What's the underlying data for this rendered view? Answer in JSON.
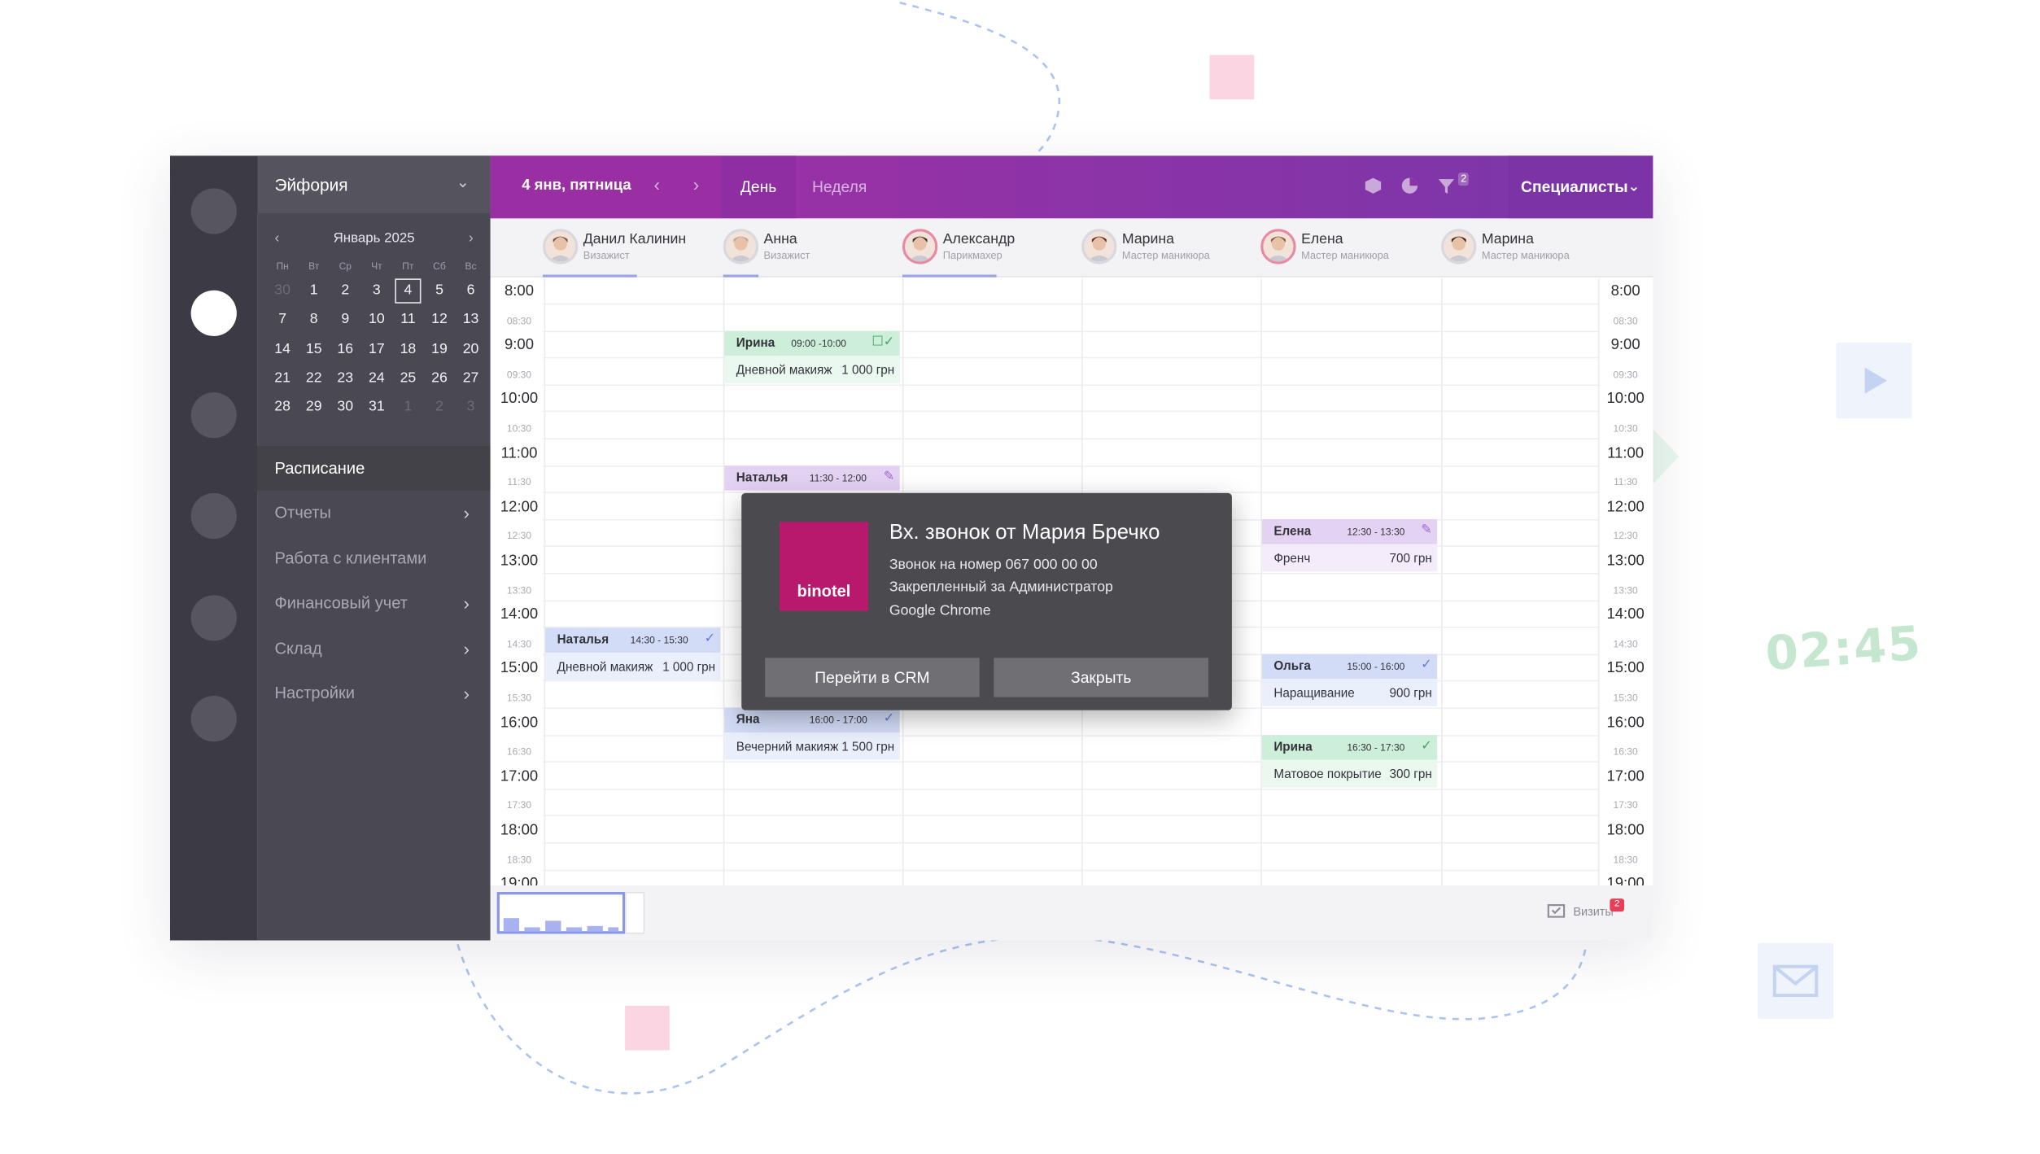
{
  "timer": "02:45",
  "sidebar": {
    "org_name": "Эйфория",
    "calendar": {
      "month_label": "Январь 2025",
      "weekdays": [
        "Пн",
        "Вт",
        "Ср",
        "Чт",
        "Пт",
        "Сб",
        "Вс"
      ],
      "days": [
        "30",
        "1",
        "2",
        "3",
        "4",
        "5",
        "6",
        "7",
        "8",
        "9",
        "10",
        "11",
        "12",
        "13",
        "14",
        "15",
        "16",
        "17",
        "18",
        "19",
        "20",
        "21",
        "22",
        "23",
        "24",
        "25",
        "26",
        "27",
        "28",
        "29",
        "30",
        "31",
        "1",
        "2",
        "3"
      ]
    },
    "menu": [
      "Расписание",
      "Отчеты",
      "Работа с клиентами",
      "Финансовый учет",
      "Склад",
      "Настройки"
    ]
  },
  "topbar": {
    "date_label": "4 янв, пятница",
    "tab_day": "День",
    "tab_week": "Неделя",
    "filter_badge": "2",
    "specialists_btn": "Специалисты"
  },
  "specialists": [
    {
      "name": "Данил Калинин",
      "role": "Визажист"
    },
    {
      "name": "Анна",
      "role": "Визажист"
    },
    {
      "name": "Александр",
      "role": "Парикмахер"
    },
    {
      "name": "Марина",
      "role": "Мастер маникюра"
    },
    {
      "name": "Елена",
      "role": "Мастер маникюра"
    },
    {
      "name": "Марина",
      "role": "Мастер маникюра"
    }
  ],
  "times": [
    {
      "label": "8:00"
    },
    {
      "label": "08:30"
    },
    {
      "label": "9:00"
    },
    {
      "label": "09:30"
    },
    {
      "label": "10:00"
    },
    {
      "label": "10:30"
    },
    {
      "label": "11:00"
    },
    {
      "label": "11:30"
    },
    {
      "label": "12:00"
    },
    {
      "label": "12:30"
    },
    {
      "label": "13:00"
    },
    {
      "label": "13:30"
    },
    {
      "label": "14:00"
    },
    {
      "label": "14:30"
    },
    {
      "label": "15:00"
    },
    {
      "label": "15:30"
    },
    {
      "label": "16:00"
    },
    {
      "label": "16:30"
    },
    {
      "label": "17:00"
    },
    {
      "label": "17:30"
    },
    {
      "label": "18:00"
    },
    {
      "label": "18:30"
    },
    {
      "label": "19:00"
    }
  ],
  "appointments": [
    {
      "client": "Ирина",
      "time": "09:00 -10:00",
      "service": "Дневной макияж",
      "price": "1 000 грн",
      "color": "green"
    },
    {
      "client": "Наталья",
      "time": "11:30 - 12:00",
      "service": "",
      "price": "",
      "color": "purple"
    },
    {
      "client": "Елена",
      "time": "12:30 - 13:30",
      "service": "Френч",
      "price": "700 грн",
      "color": "purple"
    },
    {
      "client": "Наталья",
      "time": "14:30 - 15:30",
      "service": "Дневной макияж",
      "price": "1 000 грн",
      "color": "blue"
    },
    {
      "client": "Ольга",
      "time": "15:00 - 16:00",
      "service": "Наращивание",
      "price": "900 грн",
      "color": "blue"
    },
    {
      "client": "Яна",
      "time": "16:00 - 17:00",
      "service": "Вечерний макияж",
      "price": "1 500 грн",
      "color": "blue"
    },
    {
      "client": "Ирина",
      "time": "16:30 - 17:30",
      "service": "Матовое покрытие",
      "price": "300 грн",
      "color": "green"
    }
  ],
  "popup": {
    "logo_text": "binotel",
    "title": "Вх. звонок от Мария Бречко",
    "line1": "Звонок на номер 067 000 00 00",
    "line2": "Закрепленный за Администратор",
    "line3": "Google Chrome",
    "btn_crm": "Перейти в CRM",
    "btn_close": "Закрыть"
  },
  "bottom": {
    "visits_label": "Визиты",
    "visits_badge": "2"
  },
  "colors": {
    "brand_purple": "#8a34a8",
    "binotel": "#b8196c",
    "sidebar": "#4a4953",
    "rail": "#3c3b45"
  }
}
